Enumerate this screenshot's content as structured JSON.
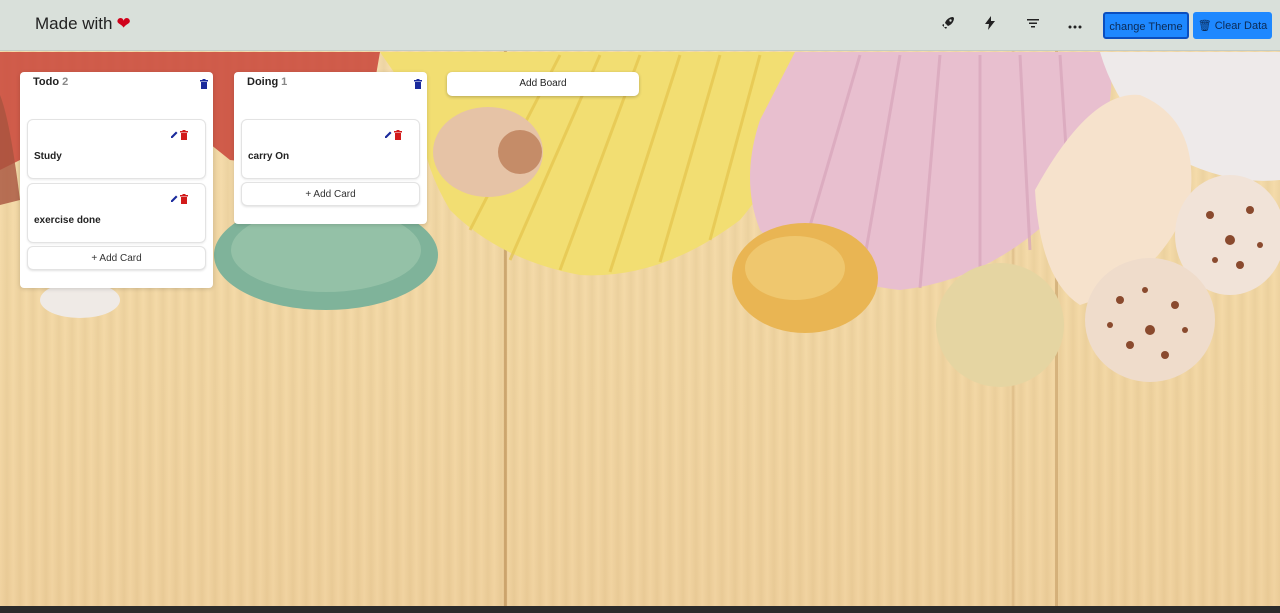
{
  "header": {
    "brand": "Made with",
    "heart": "❤",
    "icons": [
      "rocket-icon",
      "bolt-icon",
      "filter-icon",
      "more-icon"
    ],
    "change_theme": "change Theme",
    "clear_data": "🗑 Clear Data"
  },
  "boards": [
    {
      "title": "Todo",
      "count": "2",
      "cards": [
        {
          "text": "Study"
        },
        {
          "text": "exercise done"
        }
      ],
      "add_card": "+ Add Card"
    },
    {
      "title": "Doing",
      "count": "1",
      "cards": [
        {
          "text": "carry On"
        }
      ],
      "add_card": "+ Add Card"
    }
  ],
  "add_board": "Add Board",
  "colors": {
    "topbar": "#d9e0da",
    "accent": "#1e88ff",
    "delete": "#d21b1b",
    "edit": "#1a2a9c"
  }
}
